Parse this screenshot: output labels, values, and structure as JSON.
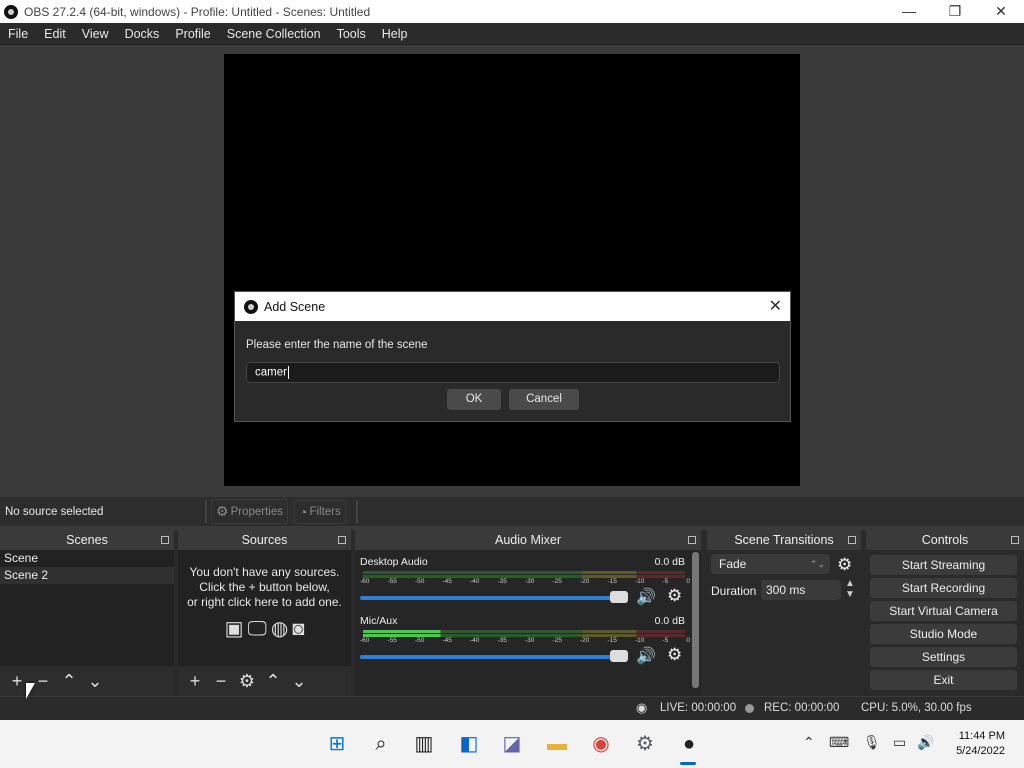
{
  "window": {
    "title": "OBS 27.2.4 (64-bit, windows) - Profile: Untitled - Scenes: Untitled",
    "minimize": "—",
    "maximize": "❐",
    "close": "✕"
  },
  "menu": [
    "File",
    "Edit",
    "View",
    "Docks",
    "Profile",
    "Scene Collection",
    "Tools",
    "Help"
  ],
  "dialog": {
    "title": "Add Scene",
    "close": "✕",
    "prompt": "Please enter the name of the scene",
    "input_value": "camer",
    "ok_label": "OK",
    "cancel_label": "Cancel"
  },
  "source_toolbar": {
    "no_source": "No source selected",
    "properties_label": "Properties",
    "filters_label": "Filters"
  },
  "scenes": {
    "title": "Scenes",
    "items": [
      "Scene",
      "Scene 2"
    ],
    "selected_index": 1
  },
  "sources": {
    "title": "Sources",
    "empty_line1": "You don't have any sources.",
    "empty_line2": "Click the + button below,",
    "empty_line3": "or right click here to add one."
  },
  "mixer": {
    "title": "Audio Mixer",
    "ticks": [
      "-60",
      "-55",
      "-50",
      "-45",
      "-40",
      "-35",
      "-30",
      "-25",
      "-20",
      "-15",
      "-10",
      "-5",
      "0"
    ],
    "channels": [
      {
        "name": "Desktop Audio",
        "db": "0.0 dB",
        "level": 0
      },
      {
        "name": "Mic/Aux",
        "db": "0.0 dB",
        "level": 0.24
      }
    ]
  },
  "transitions": {
    "title": "Scene Transitions",
    "selected": "Fade",
    "duration_label": "Duration",
    "duration_value": "300 ms"
  },
  "controls": {
    "title": "Controls",
    "buttons": [
      "Start Streaming",
      "Start Recording",
      "Start Virtual Camera",
      "Studio Mode",
      "Settings",
      "Exit"
    ]
  },
  "status": {
    "live": "LIVE: 00:00:00",
    "rec": "REC: 00:00:00",
    "cpu": "CPU: 5.0%, 30.00 fps"
  },
  "taskbar": {
    "time": "11:44 PM",
    "date": "5/24/2022"
  }
}
